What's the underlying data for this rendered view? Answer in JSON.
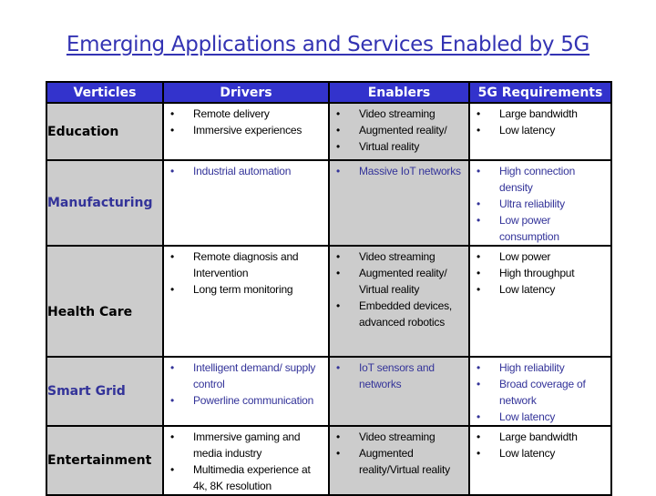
{
  "title": "Emerging Applications and Services Enabled by 5G",
  "headers": [
    "Verticles",
    "Drivers",
    "Enablers",
    "5G Requirements"
  ],
  "colors": {
    "header_bg": "#3333cc",
    "title": "#3333b3",
    "blue_text": "#333399",
    "gray_cell": "#cccccc"
  },
  "rows": [
    {
      "vertical": "Education",
      "drivers": [
        "Remote delivery",
        "Immersive experiences"
      ],
      "enablers": [
        "Video streaming",
        "Augmented reality/",
        "Virtual reality"
      ],
      "requirements": [
        "Large bandwidth",
        "Low latency"
      ]
    },
    {
      "vertical": "Manufacturing",
      "drivers": [
        "Industrial automation"
      ],
      "enablers": [
        "Massive IoT networks"
      ],
      "requirements": [
        "High connection density",
        "Ultra reliability",
        "Low power consumption"
      ]
    },
    {
      "vertical": "Health Care",
      "drivers": [
        "Remote diagnosis and Intervention",
        "Long term monitoring"
      ],
      "enablers": [
        "Video streaming",
        "Augmented reality/ Virtual reality",
        "Embedded devices, advanced robotics"
      ],
      "requirements": [
        "Low power",
        "High throughput",
        "Low latency"
      ]
    },
    {
      "vertical": "Smart Grid",
      "drivers": [
        "Intelligent demand/ supply control",
        "Powerline communication"
      ],
      "enablers": [
        "IoT sensors and networks"
      ],
      "requirements": [
        "High reliability",
        "Broad coverage of network",
        "Low latency"
      ]
    },
    {
      "vertical": "Entertainment",
      "drivers": [
        "Immersive gaming and media industry",
        "Multimedia experience at 4k, 8K resolution"
      ],
      "enablers": [
        "Video streaming",
        "Augmented reality/Virtual reality"
      ],
      "requirements": [
        "Large bandwidth",
        "Low latency"
      ]
    }
  ]
}
